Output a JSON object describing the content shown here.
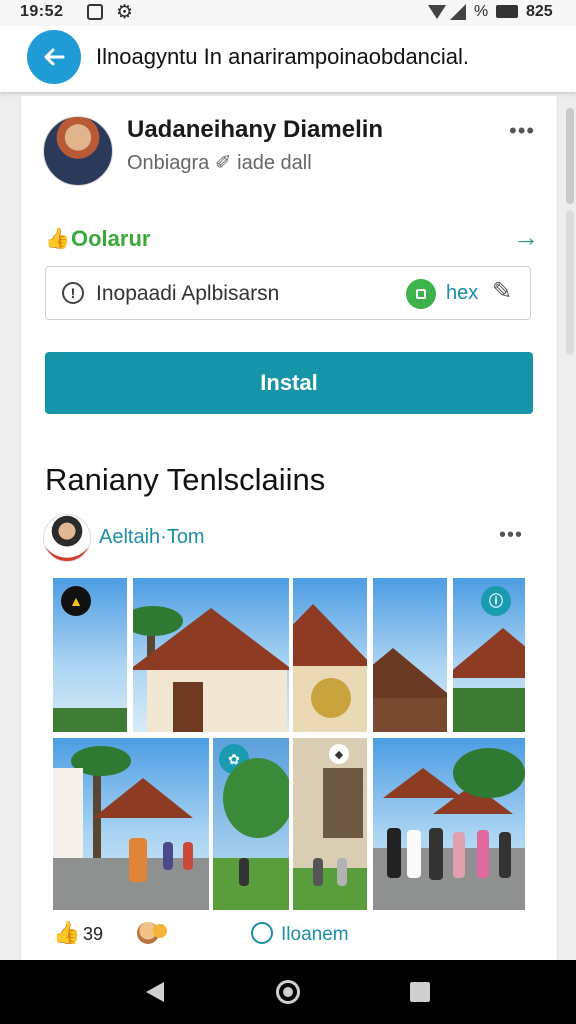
{
  "status_bar": {
    "time": "19:52",
    "battery_text": "%",
    "right_number": "825",
    "icons": [
      "notification-square-icon",
      "gear-icon",
      "wifi-icon",
      "signal-icon",
      "battery-icon"
    ]
  },
  "app_bar": {
    "back_icon": "back-arrow-icon",
    "title": "Ilnoagyntu In anarirampoinaobdancial."
  },
  "profile": {
    "name": "Uadaneihany Diamelin",
    "subtitle": "Onbiagra  ✐ iade dall",
    "more": "•••"
  },
  "offer": {
    "label": "Oolarur",
    "arrow": "→"
  },
  "search": {
    "text": "Inopaadi Aplbisarsn",
    "hex_label": "hex"
  },
  "install_button": "Instal",
  "section_title": "Raniany Tenlsclaiins",
  "post": {
    "author": "Aeltaih·Tom",
    "more": "•••"
  },
  "footer": {
    "like_count": "39",
    "comment_label": "Iloanem"
  },
  "colors": {
    "accent": "#1795a8",
    "back_button": "#1f9bd6",
    "offer_green": "#3ba83b",
    "link_teal": "#1b8fa6"
  }
}
